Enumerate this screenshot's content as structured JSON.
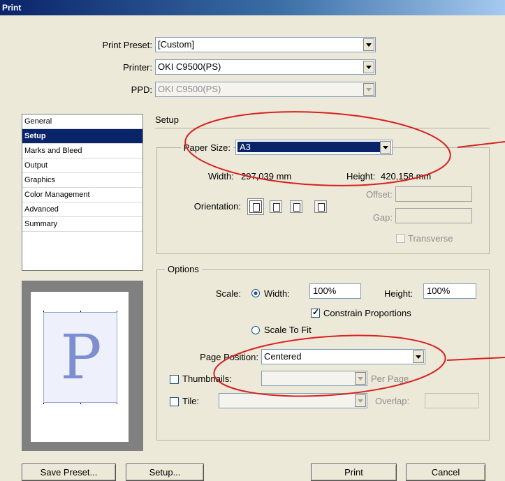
{
  "window": {
    "title": "Print"
  },
  "top": {
    "print_preset_label": "Print Preset:",
    "print_preset_value": "[Custom]",
    "printer_label": "Printer:",
    "printer_value": "OKI C9500(PS)",
    "ppd_label": "PPD:",
    "ppd_value": "OKI C9500(PS)"
  },
  "sidebar": {
    "items": [
      {
        "label": "General",
        "selected": false
      },
      {
        "label": "Setup",
        "selected": true
      },
      {
        "label": "Marks and Bleed",
        "selected": false
      },
      {
        "label": "Output",
        "selected": false
      },
      {
        "label": "Graphics",
        "selected": false
      },
      {
        "label": "Color Management",
        "selected": false
      },
      {
        "label": "Advanced",
        "selected": false
      },
      {
        "label": "Summary",
        "selected": false
      }
    ]
  },
  "preview": {
    "letter": "P"
  },
  "setup": {
    "heading": "Setup",
    "paper_size_label": "Paper Size:",
    "paper_size_value": "A3",
    "width_label": "Width:",
    "width_value": "297,039 mm",
    "height_label": "Height:",
    "height_value": "420,158 mm",
    "offset_label": "Offset:",
    "gap_label": "Gap:",
    "orientation_label": "Orientation:",
    "orientation_icons": [
      "portrait-icon",
      "landscape-icon",
      "reverse-portrait-icon",
      "reverse-landscape-icon"
    ],
    "transverse_label": "Transverse"
  },
  "options": {
    "heading": "Options",
    "scale_label": "Scale:",
    "width_label": "Width:",
    "width_value": "100%",
    "height_label": "Height:",
    "height_value": "100%",
    "constrain_label": "Constrain Proportions",
    "constrain_checked": true,
    "scale_to_fit_label": "Scale To Fit",
    "page_position_label": "Page Position:",
    "page_position_value": "Centered",
    "thumbnails_label": "Thumbnails:",
    "thumbnails_value": "",
    "per_page_label": "Per Page",
    "tile_label": "Tile:",
    "tile_value": "",
    "overlap_label": "Overlap:",
    "overlap_value": ""
  },
  "buttons": {
    "save_preset": "Save Preset...",
    "setup": "Setup...",
    "print": "Print",
    "cancel": "Cancel"
  },
  "colors": {
    "annotation": "#d92020",
    "selection": "#0a246a"
  }
}
